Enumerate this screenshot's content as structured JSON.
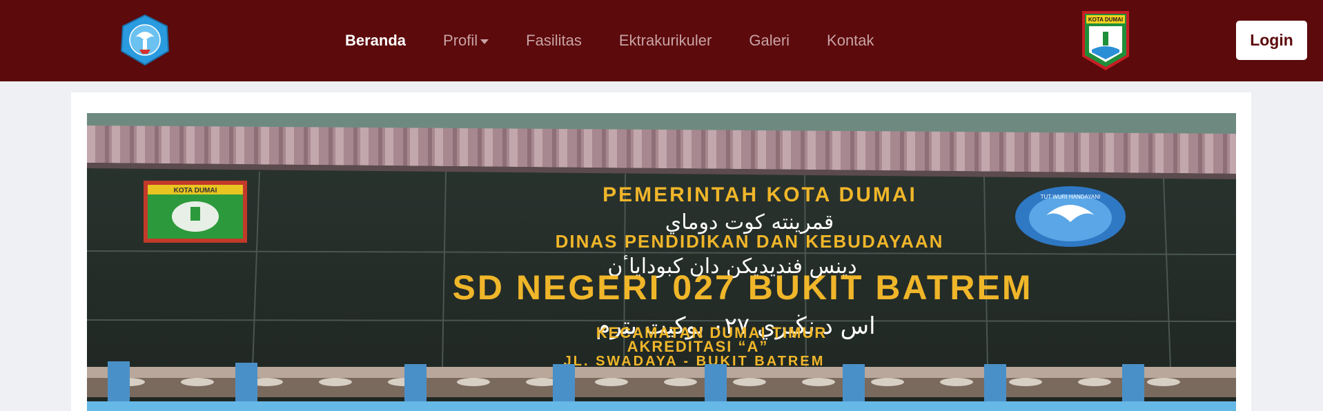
{
  "nav": {
    "items": [
      {
        "label": "Beranda",
        "active": true
      },
      {
        "label": "Profil",
        "dropdown": true
      },
      {
        "label": "Fasilitas"
      },
      {
        "label": "Ektrakurikuler"
      },
      {
        "label": "Galeri"
      },
      {
        "label": "Kontak"
      }
    ],
    "login_label": "Login",
    "left_logo_icon": "tut-wuri-handayani-logo-icon",
    "right_logo_icon": "kota-dumai-emblem-icon",
    "right_logo_text": "KOTA DUMAI"
  },
  "banner": {
    "line1": "PEMERINTAH KOTA DUMAI",
    "line1_jawi": "قمرينته كوت دوماي",
    "line2": "DINAS PENDIDIKAN DAN KEBUDAYAAN",
    "line2_jawi": "دينس فنديديكن دان كبوداياٴن",
    "line3": "SD NEGERI 027 BUKIT BATREM",
    "line3_jawi": "اس د نڬيري ٠٢٧ بوكيت بترم",
    "line4": "KECAMATAN DUMAI TIMUR",
    "line5": "AKREDITASI “A”",
    "line6": "JL. SWADAYA - BUKIT BATREM",
    "emblem_left_text": "KOTA DUMAI",
    "emblem_right_text": "TUT WURI HANDAYANI"
  },
  "colors": {
    "navbar_bg": "#5c0a0c",
    "nav_text": "#c9a3a4",
    "nav_active": "#ffffff",
    "page_bg": "#eef0f3",
    "sign_text": "#f0b62a"
  }
}
